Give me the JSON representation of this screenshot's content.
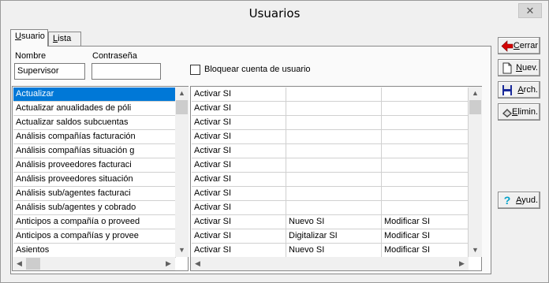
{
  "window": {
    "title": "Usuarios",
    "close_glyph": "✕"
  },
  "tabs": [
    {
      "label": "Usuario",
      "mnemonic": "U",
      "rest": "suario"
    },
    {
      "label": "Lista",
      "mnemonic": "L",
      "rest": "ista"
    }
  ],
  "form": {
    "nombre_label": "Nombre",
    "nombre_value": "Supervisor",
    "password_label": "Contraseña",
    "password_value": "",
    "block_label": "Bloquear cuenta de usuario",
    "block_checked": false
  },
  "functions_list": {
    "selected_index": 0,
    "items": [
      "Actualizar",
      "Actualizar anualidades de póli",
      "Actualizar saldos subcuentas",
      "Análisis compañías facturación",
      "Análisis compañías situación g",
      "Análisis proveedores facturaci",
      "Análisis proveedores situación",
      "Análisis sub/agentes facturaci",
      "Análisis sub/agentes y cobrado",
      "Anticipos a compañía o proveed",
      "Anticipos a compañías y provee",
      "Asientos"
    ]
  },
  "permissions_grid": {
    "rows": [
      [
        "Activar SI",
        "",
        ""
      ],
      [
        "Activar SI",
        "",
        ""
      ],
      [
        "Activar SI",
        "",
        ""
      ],
      [
        "Activar SI",
        "",
        ""
      ],
      [
        "Activar SI",
        "",
        ""
      ],
      [
        "Activar SI",
        "",
        ""
      ],
      [
        "Activar SI",
        "",
        ""
      ],
      [
        "Activar SI",
        "",
        ""
      ],
      [
        "Activar SI",
        "",
        ""
      ],
      [
        "Activar SI",
        "Nuevo SI",
        "Modificar SI"
      ],
      [
        "Activar SI",
        "Digitalizar SI",
        "Modificar SI"
      ],
      [
        "Activar SI",
        "Nuevo SI",
        "Modificar SI"
      ]
    ]
  },
  "buttons": {
    "cerrar": {
      "mnemonic": "C",
      "rest": "errar",
      "icon": "red-arrow-left-icon"
    },
    "nuevo": {
      "mnemonic": "N",
      "rest": "uev.",
      "icon": "new-document-icon"
    },
    "archivar": {
      "mnemonic": "A",
      "rest": "rch.",
      "icon": "floppy-disk-icon"
    },
    "eliminar": {
      "mnemonic": "E",
      "rest": "limin.",
      "icon": "eraser-icon"
    },
    "ayuda": {
      "mnemonic": "A",
      "rest": "yud.",
      "prefix": "",
      "icon": "question-mark-icon"
    }
  },
  "colors": {
    "selection": "#0078d7",
    "arrow_red": "#d40000",
    "help_cyan": "#00a0c8"
  }
}
